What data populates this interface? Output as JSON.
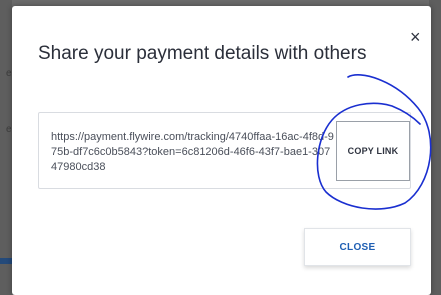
{
  "modal": {
    "title": "Share your payment details with others",
    "close_icon": "×",
    "link_url": "https://payment.flywire.com/tracking/4740ffaa-16ac-4f8d-975b-df7c6c0b5843?token=6c81206d-46f6-43f7-bae1-30747980cd38",
    "copy_button_label": "COPY LINK",
    "close_button_label": "CLOSE"
  },
  "colors": {
    "accent_blue": "#1f5fb3",
    "annotation_ink": "#1a2fd0",
    "overlay": "#6b6b6b"
  },
  "icons": {
    "close": "close-icon"
  }
}
